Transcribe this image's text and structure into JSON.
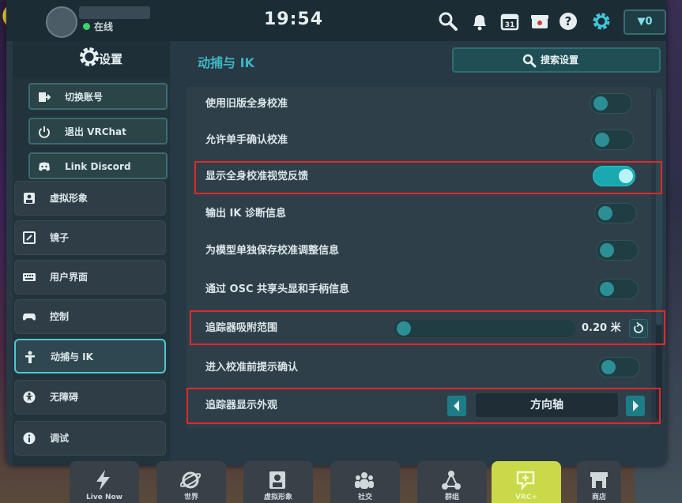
{
  "topbar": {
    "status": "在线",
    "clock": "19:54",
    "currency": "▼0",
    "icons": [
      "search-icon",
      "bell-icon",
      "calendar-icon",
      "store-icon",
      "help-icon",
      "gear-icon"
    ],
    "calendar_day": "31"
  },
  "sidebar": {
    "title": "设置",
    "account_items": [
      {
        "label": "切换账号",
        "icon": "switch-account-icon"
      },
      {
        "label": "退出 VRChat",
        "icon": "power-icon"
      },
      {
        "label": "Link Discord",
        "icon": "discord-icon"
      }
    ],
    "items": [
      {
        "label": "虚拟形象",
        "icon": "avatar-icon"
      },
      {
        "label": "镜子",
        "icon": "mirror-icon"
      },
      {
        "label": "用户界面",
        "icon": "keyboard-icon"
      },
      {
        "label": "控制",
        "icon": "gamepad-icon"
      },
      {
        "label": "动捕与 IK",
        "icon": "person-icon",
        "active": true
      },
      {
        "label": "无障碍",
        "icon": "accessibility-icon"
      },
      {
        "label": "调试",
        "icon": "info-icon"
      }
    ]
  },
  "main": {
    "title": "动捕与 IK",
    "search_label": "搜索设置",
    "settings": [
      {
        "label": "使用旧版全身校准",
        "type": "toggle",
        "on": false
      },
      {
        "label": "允许单手确认校准",
        "type": "toggle",
        "on": false
      },
      {
        "label": "显示全身校准视觉反馈",
        "type": "toggle",
        "on": true
      },
      {
        "label": "输出 IK 诊断信息",
        "type": "toggle",
        "on": false
      },
      {
        "label": "为模型单独保存校准调整信息",
        "type": "toggle",
        "on": false
      },
      {
        "label": "通过 OSC 共享头显和手柄信息",
        "type": "toggle",
        "on": false
      },
      {
        "label": "追踪器吸附范围",
        "type": "slider",
        "value": "0.20 米",
        "fraction": 0.0
      },
      {
        "label": "进入校准前提示确认",
        "type": "toggle",
        "on": false
      },
      {
        "label": "追踪器显示外观",
        "type": "select",
        "value": "方向轴"
      }
    ]
  },
  "dock": [
    {
      "label": "Live Now",
      "icon": "lightning-icon"
    },
    {
      "label": "世界",
      "icon": "planet-icon"
    },
    {
      "label": "虚拟形象",
      "icon": "avatar-icon"
    },
    {
      "label": "社交",
      "icon": "people-icon"
    },
    {
      "label": "群组",
      "icon": "group-icon"
    },
    {
      "label": "VRC+",
      "icon": "vrcplus-icon"
    },
    {
      "label": "商店",
      "icon": "shop-icon"
    }
  ],
  "colors": {
    "accent": "#3fb5c4",
    "highlight": "#e0282a",
    "toggle_on": "#1aa9b0"
  }
}
